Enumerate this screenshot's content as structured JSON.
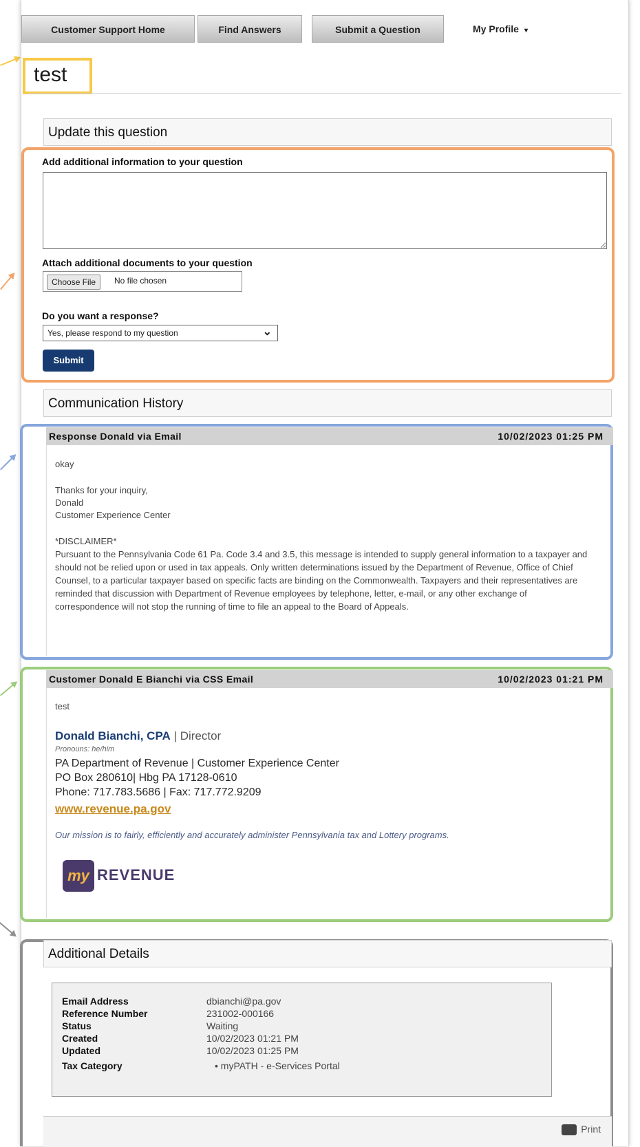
{
  "tabs": [
    "Customer Support Home",
    "Find Answers",
    "Submit a Question",
    "My Profile"
  ],
  "question_title": "test",
  "update_section": {
    "heading": "Update this question",
    "add_info_label": "Add additional information to your question",
    "attach_label": "Attach additional documents to your question",
    "file_button": "Choose File",
    "file_status": "No file chosen",
    "response_label": "Do you want a response?",
    "response_value": "Yes, please respond to my question",
    "submit_label": "Submit"
  },
  "history": {
    "heading": "Communication History",
    "messages": [
      {
        "header": "Response Donald via Email",
        "timestamp": "10/02/2023 01:25 PM",
        "body_first": "okay",
        "thanks": "Thanks for your inquiry,",
        "name": "Donald",
        "org": "Customer Experience Center",
        "disclaimer_title": "*DISCLAIMER*",
        "disclaimer": "Pursuant to the Pennsylvania Code 61 Pa. Code 3.4 and 3.5, this message is intended to supply general information to a taxpayer and should not be relied upon or used in tax appeals. Only written determinations issued by the Department of Revenue, Office of Chief Counsel, to a particular taxpayer based on specific facts are binding on the Commonwealth. Taxpayers and their representatives are reminded that discussion with Department of Revenue employees by telephone, letter, e-mail, or any other exchange of correspondence will not stop the running of time to file an appeal to the Board of Appeals."
      },
      {
        "header": "Customer Donald E Bianchi via CSS Email",
        "timestamp": "10/02/2023 01:21 PM",
        "body_first": "test",
        "sig_name": "Donald Bianchi, CPA",
        "sig_sep": " | ",
        "sig_role": "Director",
        "pronoun": "Pronouns: he/him",
        "dept": "PA Department of Revenue | Customer Experience Center",
        "address": "PO Box 280610| Hbg PA 17128-0610",
        "phone": "Phone: 717.783.5686 | Fax: 717.772.9209",
        "website": "www.revenue.pa.gov",
        "mission": "Our mission is to fairly, efficiently and accurately administer Pennsylvania tax and Lottery programs.",
        "logo_badge": "my",
        "logo_word": "REVENUE"
      }
    ]
  },
  "details": {
    "heading": "Additional Details",
    "rows": [
      {
        "key": "Email Address",
        "value": "dbianchi@pa.gov"
      },
      {
        "key": "Reference Number",
        "value": "231002-000166"
      },
      {
        "key": "Status",
        "value": "Waiting"
      },
      {
        "key": "Created",
        "value": "10/02/2023 01:21 PM"
      },
      {
        "key": "Updated",
        "value": "10/02/2023 01:25 PM"
      },
      {
        "key": "Tax Category",
        "value": "•   myPATH - e-Services Portal"
      }
    ],
    "print_label": "Print"
  },
  "colors": {
    "submit": "#173a70",
    "title_highlight": "#f7c948",
    "form_highlight": "#f2a46a",
    "response_highlight": "#86a6dc",
    "customer_highlight": "#9ccc7c",
    "details_highlight": "#8f8f8f"
  }
}
